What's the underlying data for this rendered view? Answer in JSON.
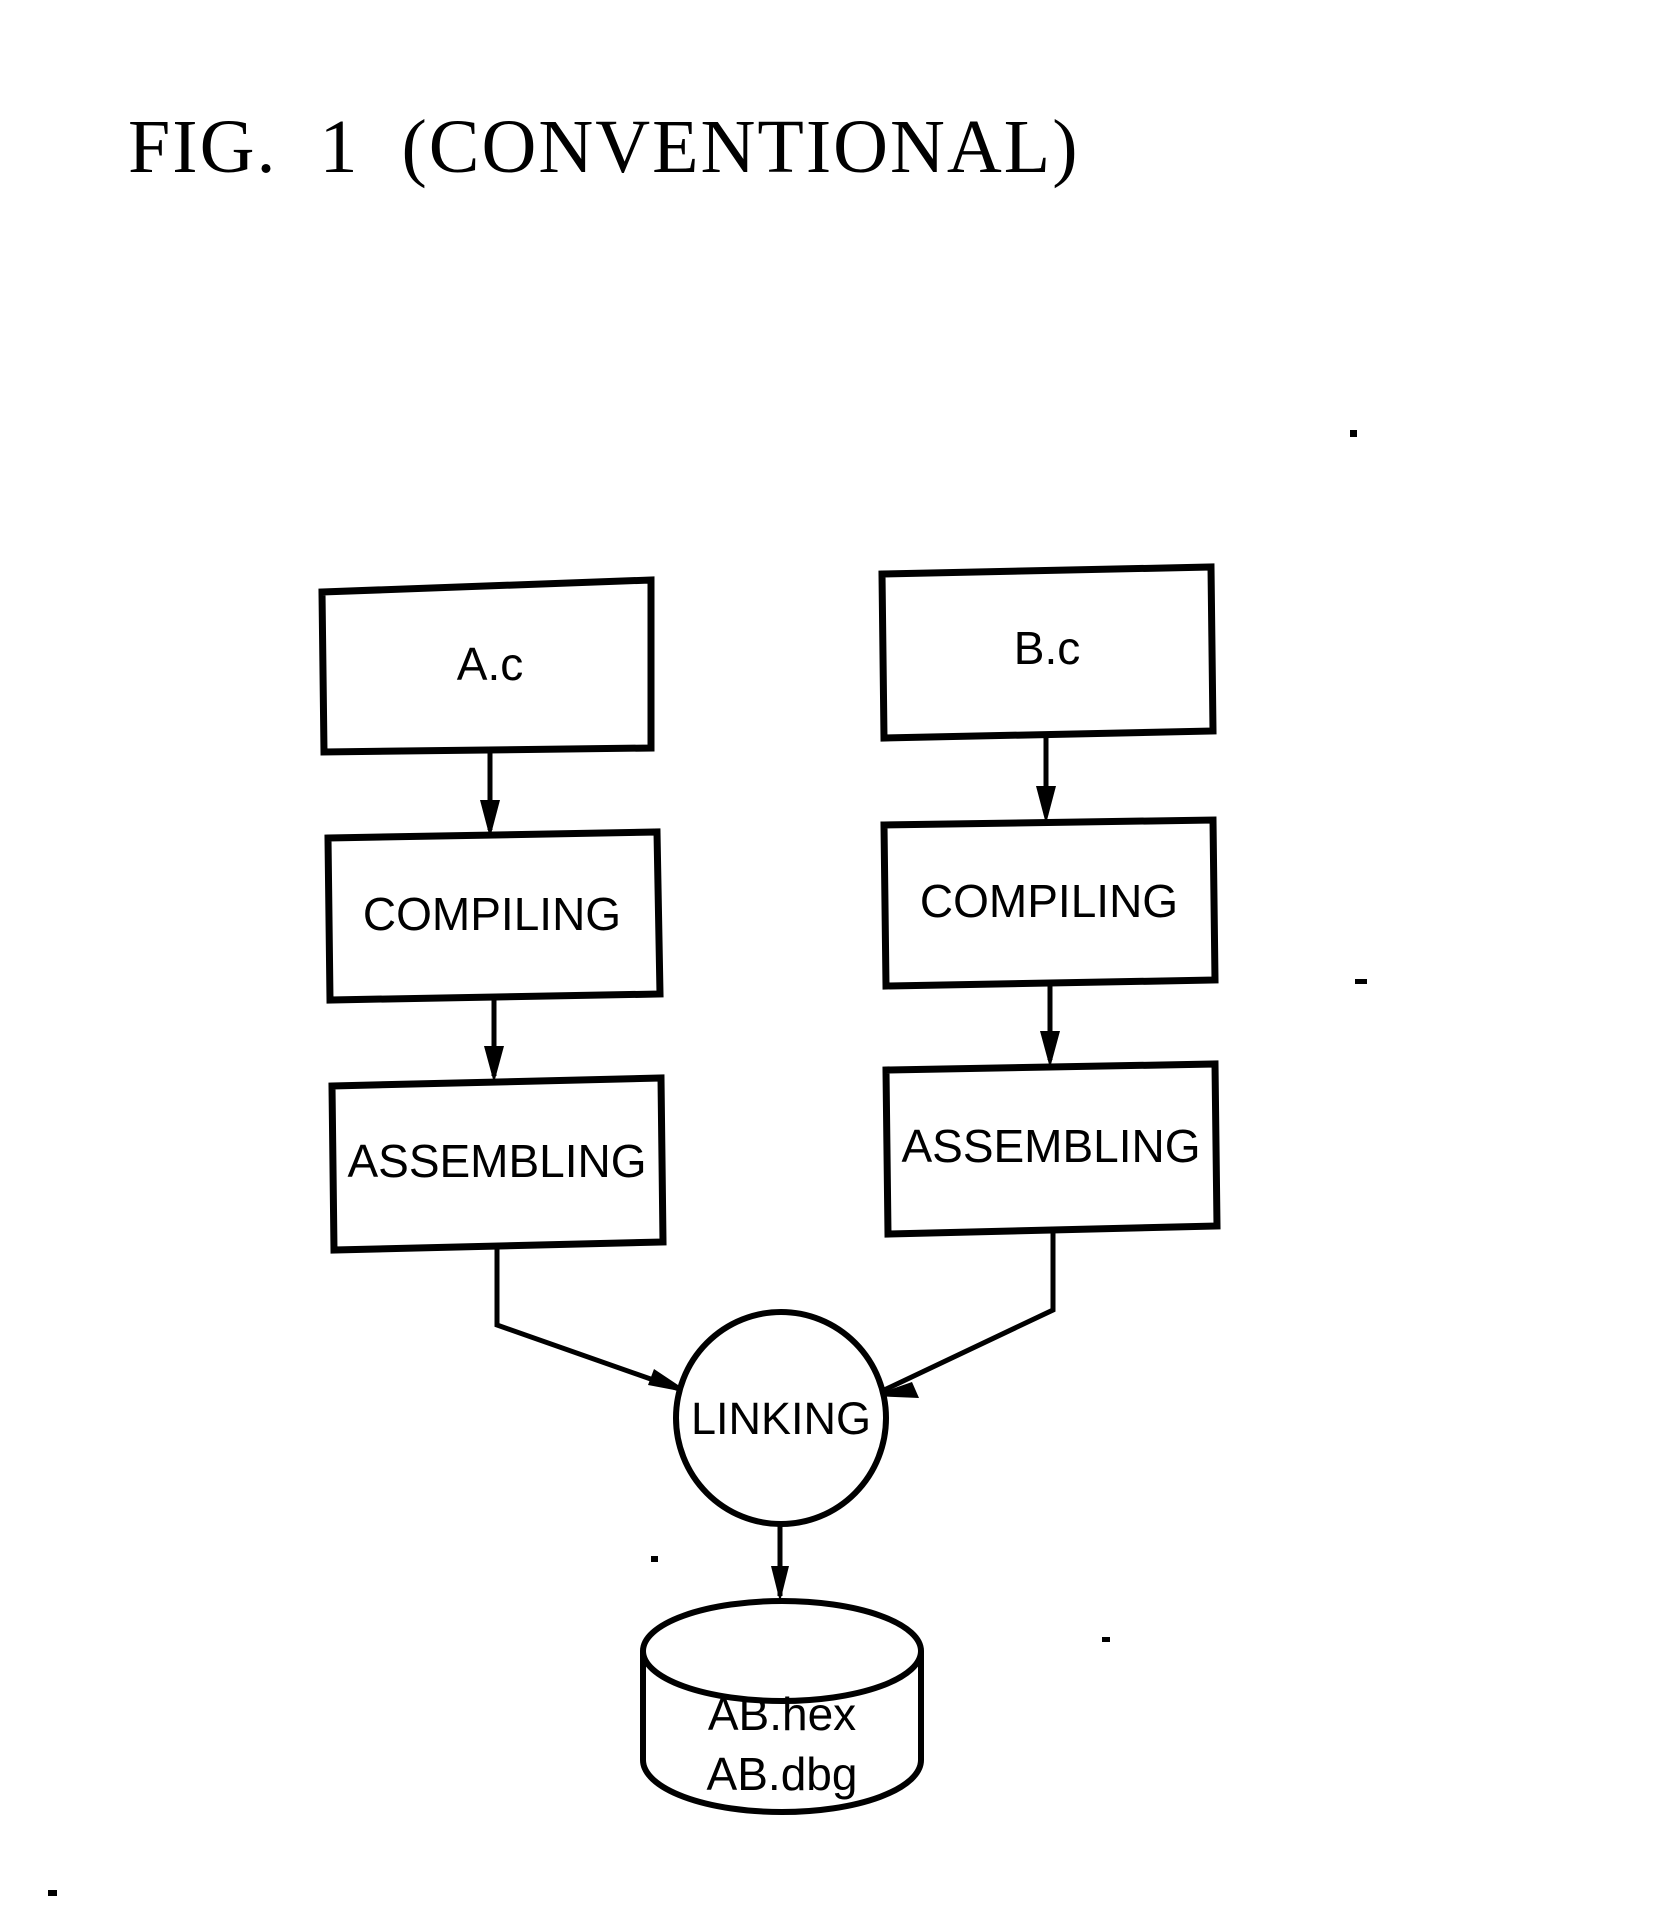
{
  "figure": {
    "title": "FIG.  1  (CONVENTIONAL)"
  },
  "diagram": {
    "type": "flowchart",
    "nodes": [
      {
        "id": "a_c",
        "label": "A.c",
        "shape": "rectangle",
        "column": "left"
      },
      {
        "id": "b_c",
        "label": "B.c",
        "shape": "rectangle",
        "column": "right"
      },
      {
        "id": "compiling_left",
        "label": "COMPILING",
        "shape": "rectangle",
        "column": "left"
      },
      {
        "id": "compiling_right",
        "label": "COMPILING",
        "shape": "rectangle",
        "column": "right"
      },
      {
        "id": "assembling_left",
        "label": "ASSEMBLING",
        "shape": "rectangle",
        "column": "left"
      },
      {
        "id": "assembling_right",
        "label": "ASSEMBLING",
        "shape": "rectangle",
        "column": "right"
      },
      {
        "id": "linking",
        "label": "LINKING",
        "shape": "circle",
        "column": "center"
      },
      {
        "id": "output_store",
        "label_line1": "AB.hex",
        "label_line2": "AB.dbg",
        "shape": "cylinder",
        "column": "center"
      }
    ],
    "edges": [
      {
        "from": "a_c",
        "to": "compiling_left",
        "arrow": true
      },
      {
        "from": "b_c",
        "to": "compiling_right",
        "arrow": true
      },
      {
        "from": "compiling_left",
        "to": "assembling_left",
        "arrow": true
      },
      {
        "from": "compiling_right",
        "to": "assembling_right",
        "arrow": true
      },
      {
        "from": "assembling_left",
        "to": "linking",
        "arrow": true
      },
      {
        "from": "assembling_right",
        "to": "linking",
        "arrow": true
      },
      {
        "from": "linking",
        "to": "output_store",
        "arrow": true
      }
    ]
  },
  "colors": {
    "ink": "#000000",
    "paper": "#ffffff"
  }
}
